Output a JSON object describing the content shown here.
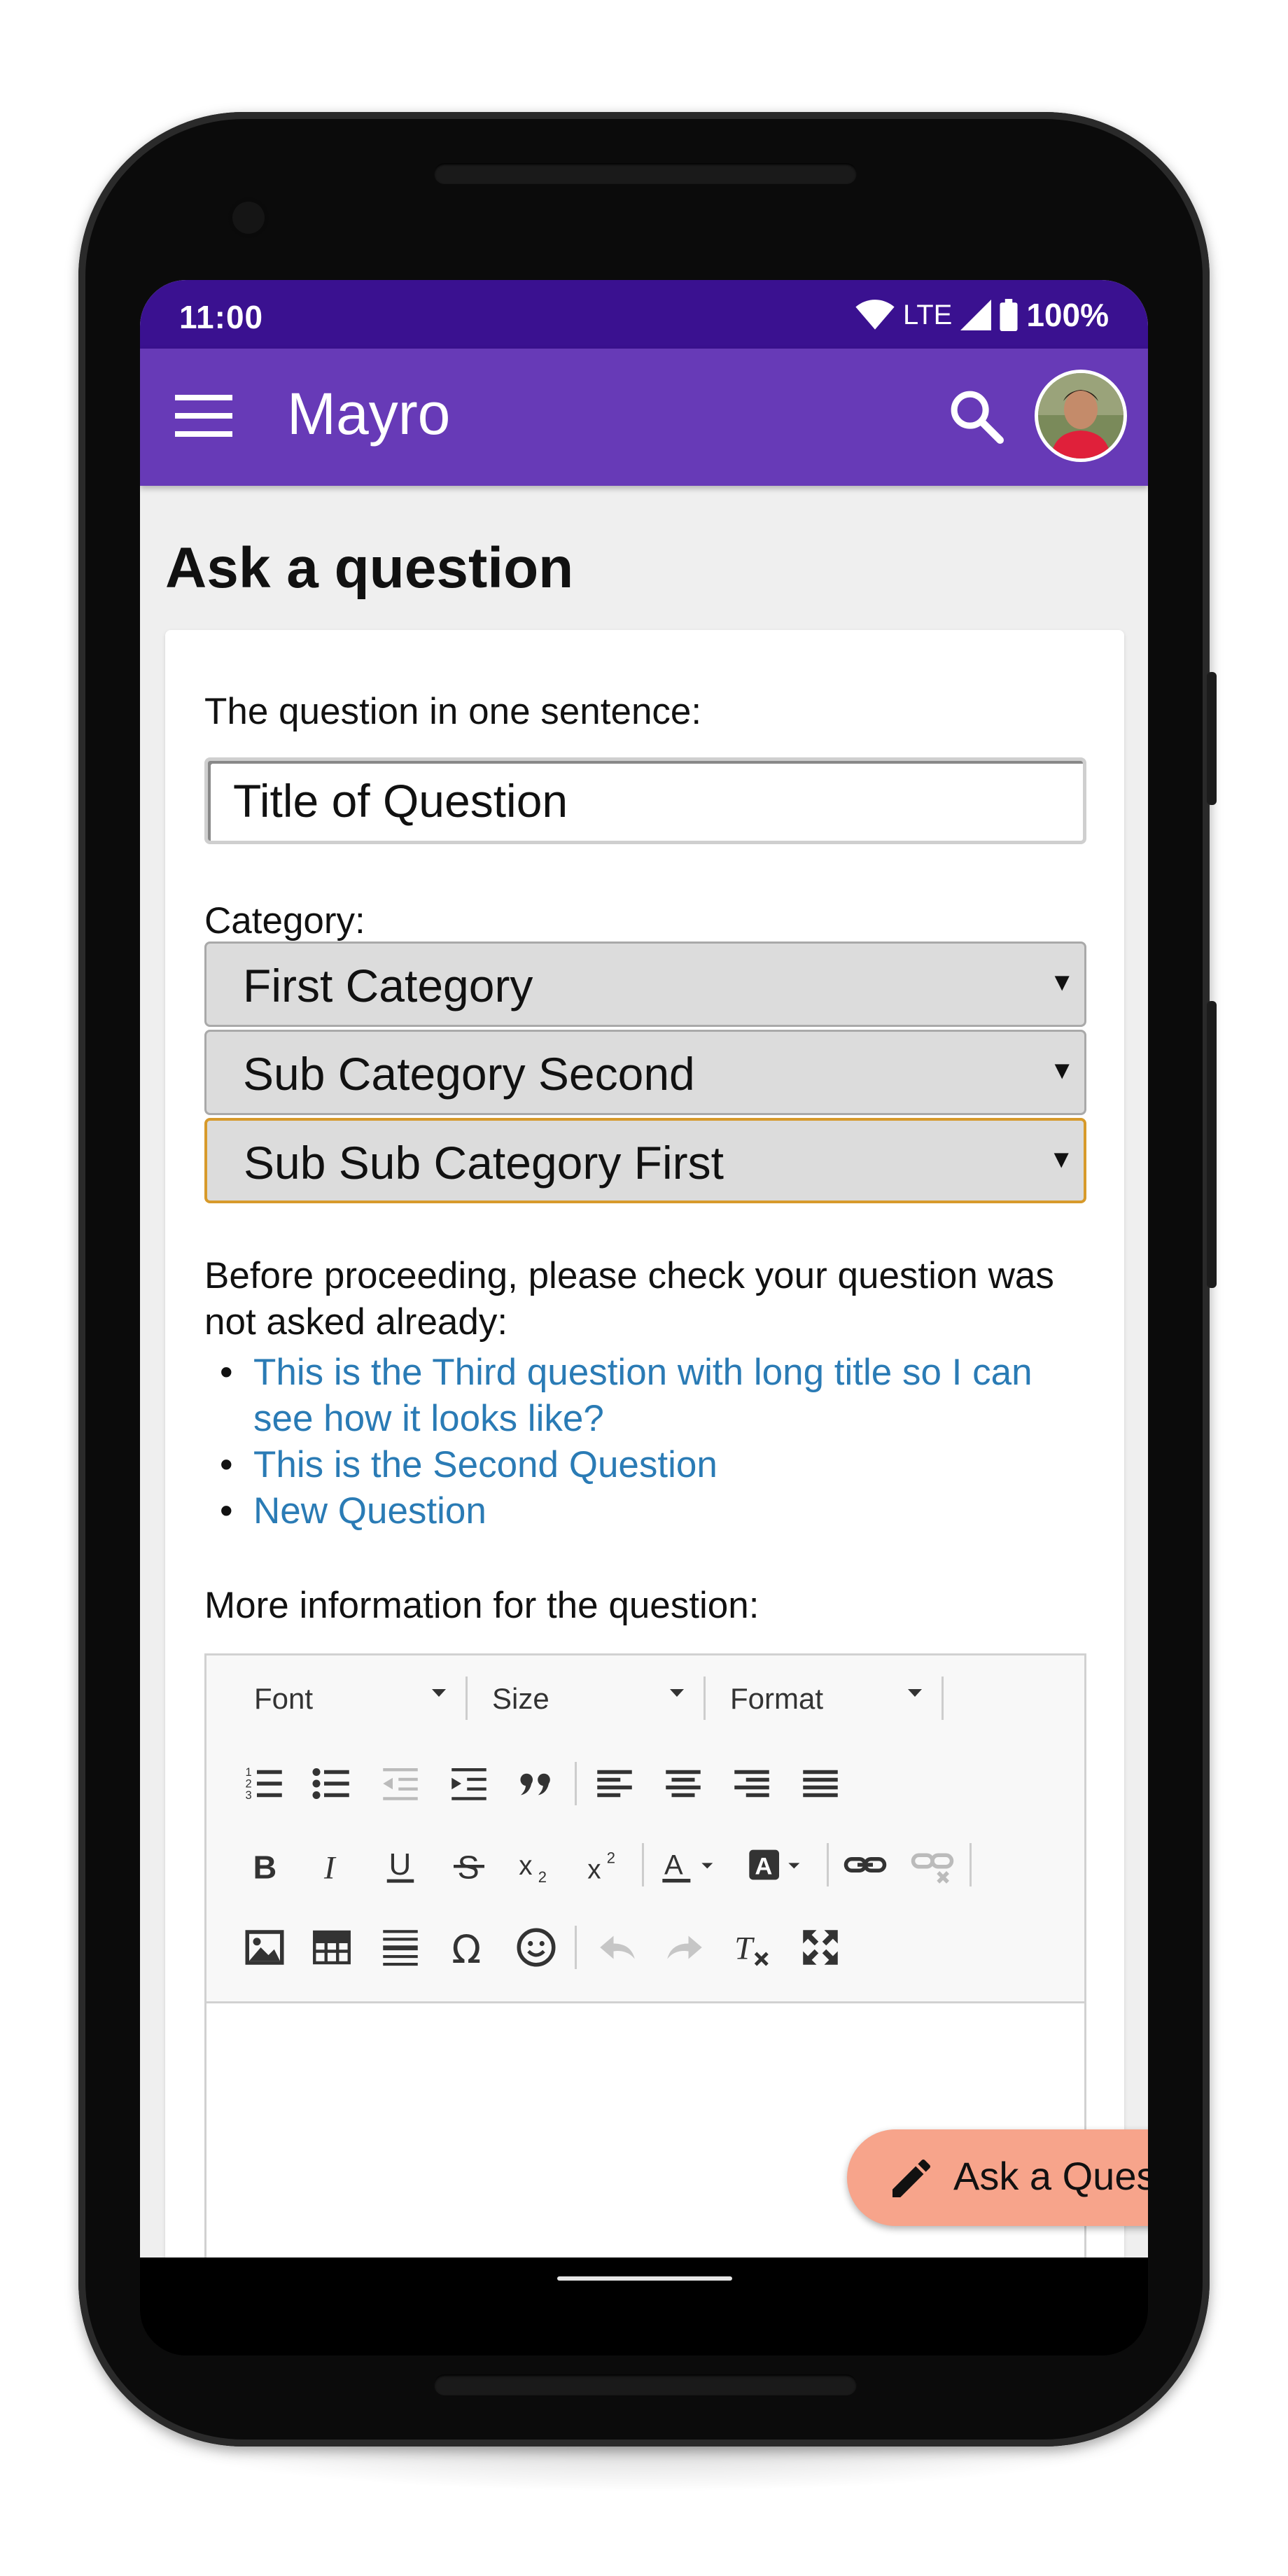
{
  "status_bar": {
    "time": "11:00",
    "network": "LTE",
    "battery": "100%"
  },
  "app_bar": {
    "title": "Mayro",
    "menu_icon": "hamburger-menu-icon",
    "search_icon": "search-icon"
  },
  "page": {
    "heading": "Ask a question"
  },
  "form": {
    "question_label": "The question in one sentence:",
    "question_value": "Title of Question",
    "category_label": "Category:",
    "categories": [
      "First Category",
      "Sub Category Second",
      "Sub Sub Category First"
    ],
    "notice": "Before proceeding, please check your question was not asked already:",
    "similar_questions": [
      "This is the Third question with long title so I can see how it looks like?",
      "This is the Second Question",
      "New Question"
    ],
    "more_info_label": "More information for the question:"
  },
  "editor": {
    "font_label": "Font",
    "size_label": "Size",
    "format_label": "Format"
  },
  "fab": {
    "label": "Ask a Question",
    "icon": "pencil-icon"
  },
  "colors": {
    "status_bar": "#3a1190",
    "app_bar": "#673ab7",
    "link": "#2a7bb5",
    "fab": "#f7a48b",
    "focus_border": "#d79a2b"
  }
}
